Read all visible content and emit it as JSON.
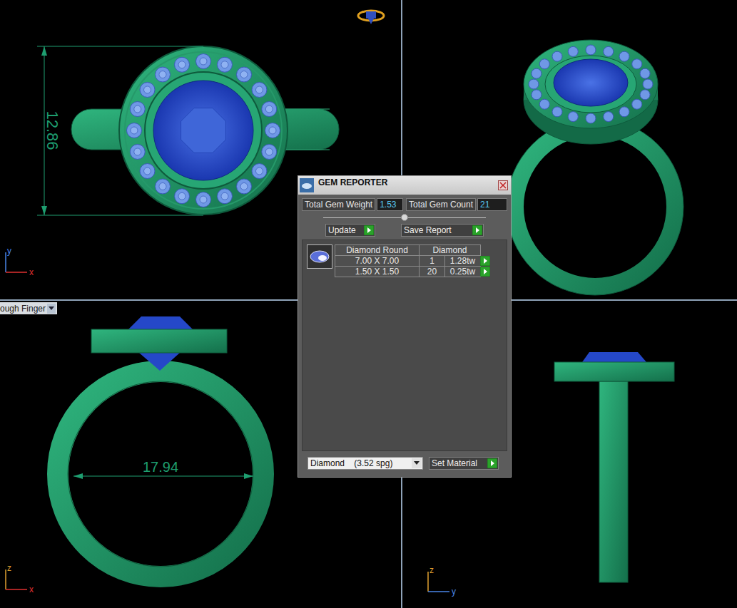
{
  "viewports": {
    "top": {
      "dimension": "12.86",
      "axes": [
        "y",
        "x"
      ]
    },
    "perspective": {},
    "front": {
      "dimension": "17.94",
      "view_menu": "ough Finger",
      "axes": [
        "z",
        "x"
      ]
    },
    "right": {
      "axes": [
        "z",
        "y"
      ]
    }
  },
  "dialog": {
    "title": "GEM REPORTER",
    "total_weight": {
      "label": "Total Gem Weight",
      "value": "1.53"
    },
    "total_count": {
      "label": "Total Gem Count",
      "value": "21"
    },
    "buttons": [
      "Update",
      "Save Report"
    ],
    "table": {
      "columns": [
        "Diamond Round",
        "Diamond"
      ],
      "rows": [
        {
          "size": "7.00 X 7.00",
          "count": "1",
          "weight": "1.28tw"
        },
        {
          "size": "1.50 X 1.50",
          "count": "20",
          "weight": "0.25tw"
        }
      ]
    },
    "material": "Diamond    (3.52 spg)",
    "set_material": "Set Material"
  }
}
